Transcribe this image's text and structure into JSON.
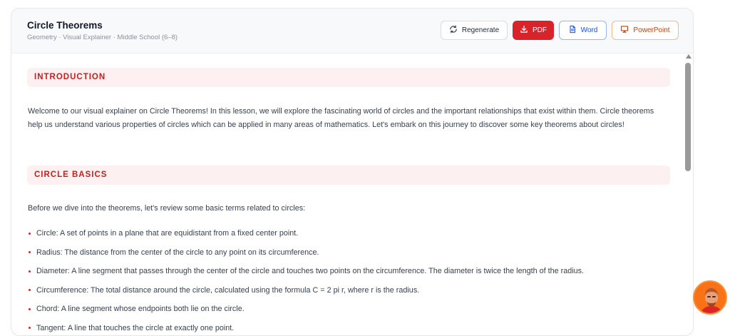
{
  "header": {
    "title": "Circle Theorems",
    "subtitle": "Geometry · Visual Explainer · Middle School (6–8)",
    "buttons": {
      "regenerate": "Regenerate",
      "pdf": "PDF",
      "word": "Word",
      "powerpoint": "PowerPoint"
    }
  },
  "sections": [
    {
      "heading": "INTRODUCTION",
      "paragraph": "Welcome to our visual explainer on Circle Theorems! In this lesson, we will explore the fascinating world of circles and the important relationships that exist within them. Circle theorems help us understand various properties of circles which can be applied in many areas of mathematics. Let's embark on this journey to discover some key theorems about circles!"
    },
    {
      "heading": "CIRCLE BASICS",
      "paragraph": "Before we dive into the theorems, let's review some basic terms related to circles:",
      "bullets": [
        "Circle: A set of points in a plane that are equidistant from a fixed center point.",
        "Radius: The distance from the center of the circle to any point on its circumference.",
        "Diameter: A line segment that passes through the center of the circle and touches two points on the circumference. The diameter is twice the length of the radius.",
        "Circumference: The total distance around the circle, calculated using the formula C = 2 pi r, where r is the radius.",
        "Chord: A line segment whose endpoints both lie on the circle.",
        "Tangent: A line that touches the circle at exactly one point."
      ]
    }
  ],
  "colors": {
    "accent": "#d9232b",
    "section_bg": "#fdf0f0",
    "word": "#1d4ed8",
    "powerpoint": "#c2410c"
  },
  "icons": {
    "regenerate": "refresh-icon",
    "pdf": "download-icon",
    "word": "document-icon",
    "powerpoint": "presentation-icon"
  }
}
